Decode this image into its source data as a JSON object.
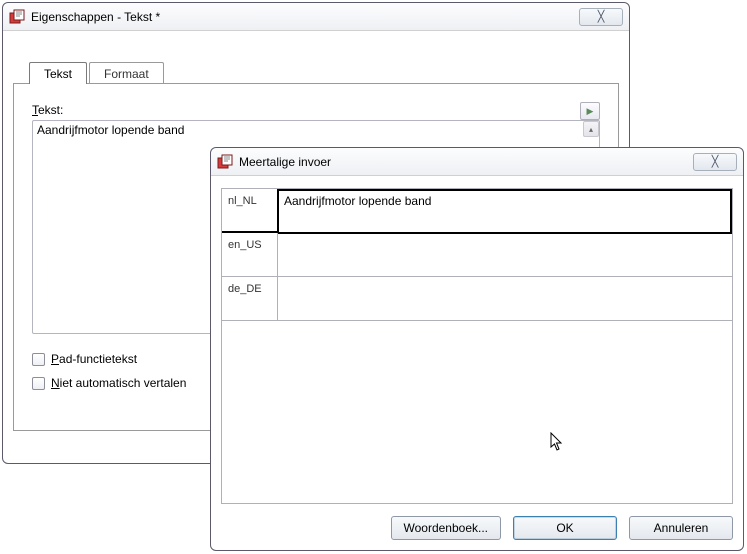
{
  "win1": {
    "title": "Eigenschappen - Tekst *",
    "close_symbol": "╳",
    "tabs": {
      "tekst": "Tekst",
      "formaat": "Formaat"
    },
    "field_label_prefix": "T",
    "field_label_rest": "ekst:",
    "tekst_value": "Aandrijfmotor lopende band",
    "scroll_up_symbol": "▴",
    "expand_symbol": "▶",
    "cb1_prefix": "P",
    "cb1_rest": "ad-functietekst",
    "cb2_prefix": "N",
    "cb2_rest": "iet automatisch vertalen"
  },
  "win2": {
    "title": "Meertalige invoer",
    "close_symbol": "╳",
    "rows": [
      {
        "code": "nl_NL",
        "value": "Aandrijfmotor lopende band"
      },
      {
        "code": "en_US",
        "value": ""
      },
      {
        "code": "de_DE",
        "value": ""
      }
    ],
    "buttons": {
      "dict": "Woordenboek...",
      "ok": "OK",
      "cancel": "Annuleren"
    }
  }
}
